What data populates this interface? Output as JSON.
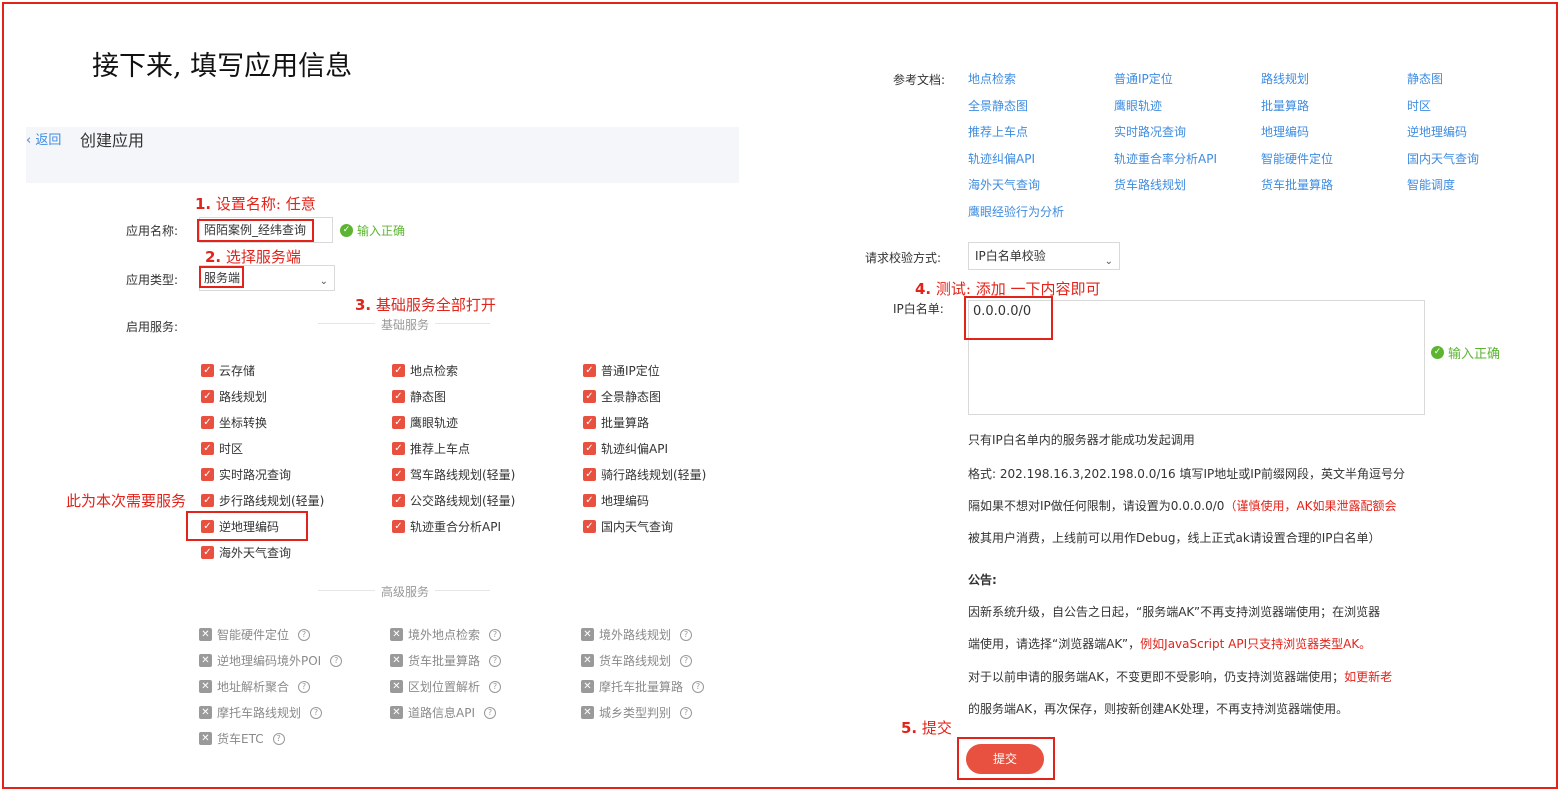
{
  "title": "接下来, 填写应用信息",
  "header": {
    "back_label": "返回",
    "page_title": "创建应用"
  },
  "annotations": {
    "a1_num": "1.",
    "a1_text": "设置名称: 任意",
    "a2_num": "2.",
    "a2_text": "选择服务端",
    "a3_num": "3.",
    "a3_text": "基础服务全部打开",
    "a4_num": "4.",
    "a4_text": "测试: 添加 一下内容即可",
    "a5_num": "5.",
    "a5_text": "提交",
    "side_note": "此为本次需要服务"
  },
  "form": {
    "name_label": "应用名称:",
    "name_value": "陌陌案例_经纬查询",
    "name_ok": "输入正确",
    "type_label": "应用类型:",
    "type_value": "服务端",
    "services_label": "启用服务:",
    "basic_section": "基础服务",
    "advanced_section": "高级服务",
    "basic_services": [
      "云存储",
      "地点检索",
      "普通IP定位",
      "路线规划",
      "静态图",
      "全景静态图",
      "坐标转换",
      "鹰眼轨迹",
      "批量算路",
      "时区",
      "推荐上车点",
      "轨迹纠偏API",
      "实时路况查询",
      "驾车路线规划(轻量)",
      "骑行路线规划(轻量)",
      "步行路线规划(轻量)",
      "公交路线规划(轻量)",
      "地理编码",
      "逆地理编码",
      "轨迹重合分析API",
      "国内天气查询",
      "海外天气查询"
    ],
    "advanced_services": [
      "智能硬件定位",
      "境外地点检索",
      "境外路线规划",
      "逆地理编码境外POI",
      "货车批量算路",
      "货车路线规划",
      "地址解析聚合",
      "区划位置解析",
      "摩托车批量算路",
      "摩托车路线规划",
      "道路信息API",
      "城乡类型判别",
      "货车ETC"
    ]
  },
  "right": {
    "docs_label": "参考文档:",
    "docs": [
      "地点检索",
      "普通IP定位",
      "路线规划",
      "静态图",
      "全景静态图",
      "鹰眼轨迹",
      "批量算路",
      "时区",
      "推荐上车点",
      "实时路况查询",
      "地理编码",
      "逆地理编码",
      "轨迹纠偏API",
      "轨迹重合率分析API",
      "智能硬件定位",
      "国内天气查询",
      "海外天气查询",
      "货车路线规划",
      "货车批量算路",
      "智能调度",
      "鹰眼经验行为分析"
    ],
    "verify_label": "请求校验方式:",
    "verify_value": "IP白名单校验",
    "whitelist_label": "IP白名单:",
    "whitelist_value": "0.0.0.0/0",
    "whitelist_ok": "输入正确",
    "warn": "只有IP白名单内的服务器才能成功发起调用",
    "format_line": "格式: 202.198.16.3,202.198.0.0/16 填写IP地址或IP前缀网段，英文半角逗号分",
    "line2_black": "隔如果不想对IP做任何限制，请设置为0.0.0.0/0",
    "line2_red": "（谨慎使用，AK如果泄露配额会",
    "line3_red": "被其用户消费，上线前可以用作Debug，线上正式ak请设置合理的IP白名单）",
    "notice_title": "公告:",
    "notice1": "因新系统升级，自公告之日起，“服务端AK”不再支持浏览器端使用；在浏览器",
    "notice2_black": "端使用，请选择“浏览器端AK”，",
    "notice2_red": "例如JavaScript API只支持浏览器类型AK。",
    "notice3_black": "对于以前申请的服务端AK，不变更即不受影响，仍支持浏览器端使用；",
    "notice3_red": "如更新老",
    "notice4_red": "的服务端AK，再次保存，则按新创建AK处理，不再支持浏览器端使用。",
    "submit_label": "提交"
  }
}
